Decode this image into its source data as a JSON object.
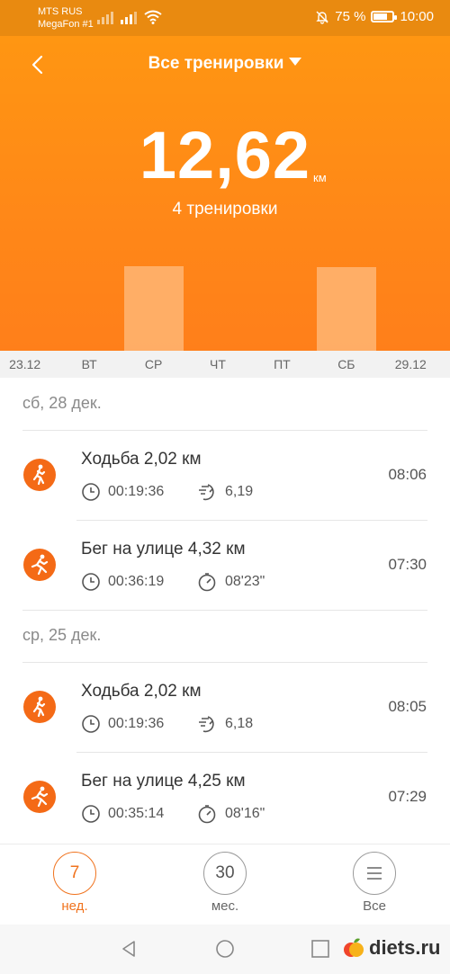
{
  "status_bar": {
    "carrier_1": "MTS RUS",
    "carrier_2": "MegaFon #1",
    "battery": "75 %",
    "battery_level": 0.75,
    "time": "10:00"
  },
  "header": {
    "title": "Все тренировки",
    "total_distance": "12,62",
    "distance_unit": "км",
    "workouts_count": "4 тренировки"
  },
  "chart_data": {
    "type": "bar",
    "categories": [
      "23.12",
      "ВТ",
      "СР",
      "ЧТ",
      "ПТ",
      "СБ",
      "29.12"
    ],
    "values": [
      0,
      0,
      6.34,
      0,
      0,
      6.28,
      0
    ]
  },
  "sections": [
    {
      "date": "сб, 28 дек.",
      "items": [
        {
          "title": "Ходьба 2,02 км",
          "duration": "00:19:36",
          "metric": "6,19",
          "metric_icon": "speed-icon",
          "time": "08:06",
          "icon": "walk-icon"
        },
        {
          "title": "Бег на улице 4,32 км",
          "duration": "00:36:19",
          "metric": "08'23\"",
          "metric_icon": "pace-icon",
          "time": "07:30",
          "icon": "run-icon"
        }
      ]
    },
    {
      "date": "ср, 25 дек.",
      "items": [
        {
          "title": "Ходьба 2,02 км",
          "duration": "00:19:36",
          "metric": "6,18",
          "metric_icon": "speed-icon",
          "time": "08:05",
          "icon": "walk-icon"
        },
        {
          "title": "Бег на улице 4,25 км",
          "duration": "00:35:14",
          "metric": "08'16\"",
          "metric_icon": "pace-icon",
          "time": "07:29",
          "icon": "run-icon"
        }
      ]
    }
  ],
  "bottom_nav": [
    {
      "value": "7",
      "label": "нед.",
      "active": true
    },
    {
      "value": "30",
      "label": "мес.",
      "active": false
    },
    {
      "value": "",
      "label": "Все",
      "active": false
    }
  ],
  "watermark": {
    "text": "diets.ru"
  },
  "colors": {
    "accent": "#f46a16",
    "header_bg": "#ff8c16",
    "nav_active": "#f0731e"
  }
}
